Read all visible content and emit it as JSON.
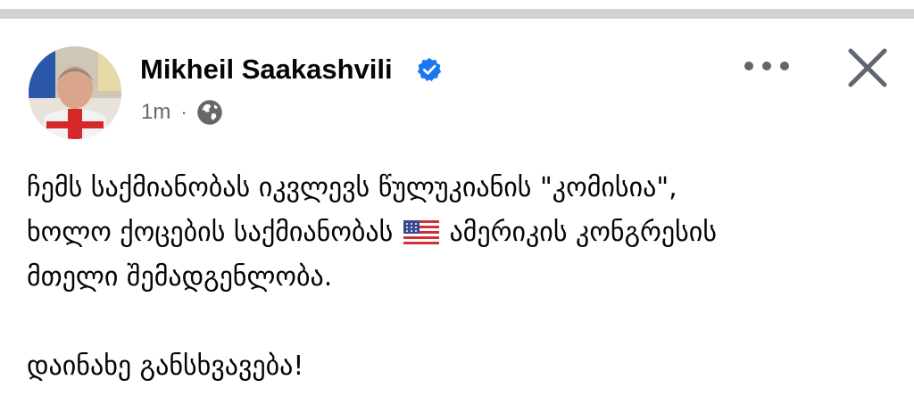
{
  "post": {
    "author": {
      "name": "Mikheil Saakashvili",
      "verified": true,
      "avatar_icon": "profile-photo"
    },
    "timestamp": "1m",
    "separator": "·",
    "audience_icon": "globe-icon",
    "actions": {
      "more_icon": "more-horizontal-icon",
      "close_icon": "close-icon"
    },
    "body": {
      "line1": "ჩემს საქმიანობას იკვლევს წულუკიანის \"კომისია\",",
      "line2_before_flag": "ხოლო ქოცების საქმიანობას",
      "line2_after_flag": "ამერიკის კონგრესის",
      "line3": "მთელი შემადგენლობა.",
      "line4": "დაინახე განსხვავება!",
      "flag_emoji": "us-flag-emoji"
    }
  },
  "colors": {
    "divider": "#cfd1d4",
    "verified_blue": "#1877f2",
    "secondary_text": "#65676b",
    "icon_gray": "#606770"
  }
}
